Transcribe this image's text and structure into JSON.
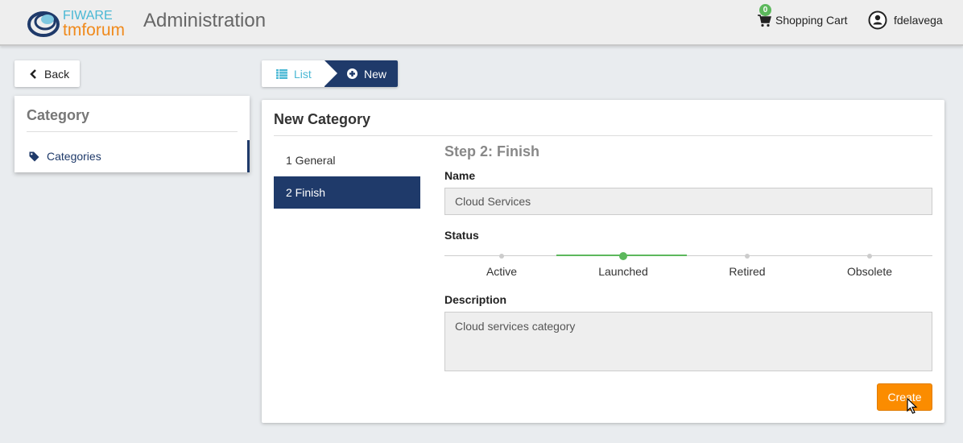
{
  "header": {
    "logo_alt": "FIWARE tmforum",
    "logo_text_top": "FIWARE",
    "logo_text_bottom": "tmforum",
    "title": "Administration",
    "cart": {
      "label": "Shopping Cart",
      "count": "0",
      "icon": "shopping-cart-icon",
      "badge_color": "#5cb85c"
    },
    "user": {
      "name": "fdelavega",
      "icon": "user-circle-icon"
    }
  },
  "sidebar": {
    "back_label": "Back",
    "title": "Category",
    "items": [
      {
        "label": "Categories",
        "icon": "tag-icon",
        "active": true
      }
    ]
  },
  "breadcrumb": {
    "items": [
      {
        "label": "List",
        "icon": "list-icon",
        "active": false
      },
      {
        "label": "New",
        "icon": "plus-circle-icon",
        "active": true
      }
    ]
  },
  "main": {
    "title": "New Category",
    "steps": [
      {
        "label": "1 General",
        "active": false
      },
      {
        "label": "2 Finish",
        "active": true
      }
    ],
    "step_heading": "Step 2: Finish",
    "name_label": "Name",
    "name_value": "Cloud Services",
    "status_label": "Status",
    "status_options": [
      "Active",
      "Launched",
      "Retired",
      "Obsolete"
    ],
    "status_selected": "Launched",
    "description_label": "Description",
    "description_value": "Cloud services category",
    "create_label": "Create"
  },
  "colors": {
    "primary": "#1f3a6a",
    "accent": "#fb8c00",
    "link": "#4ab8d4",
    "success": "#5cb85c"
  }
}
